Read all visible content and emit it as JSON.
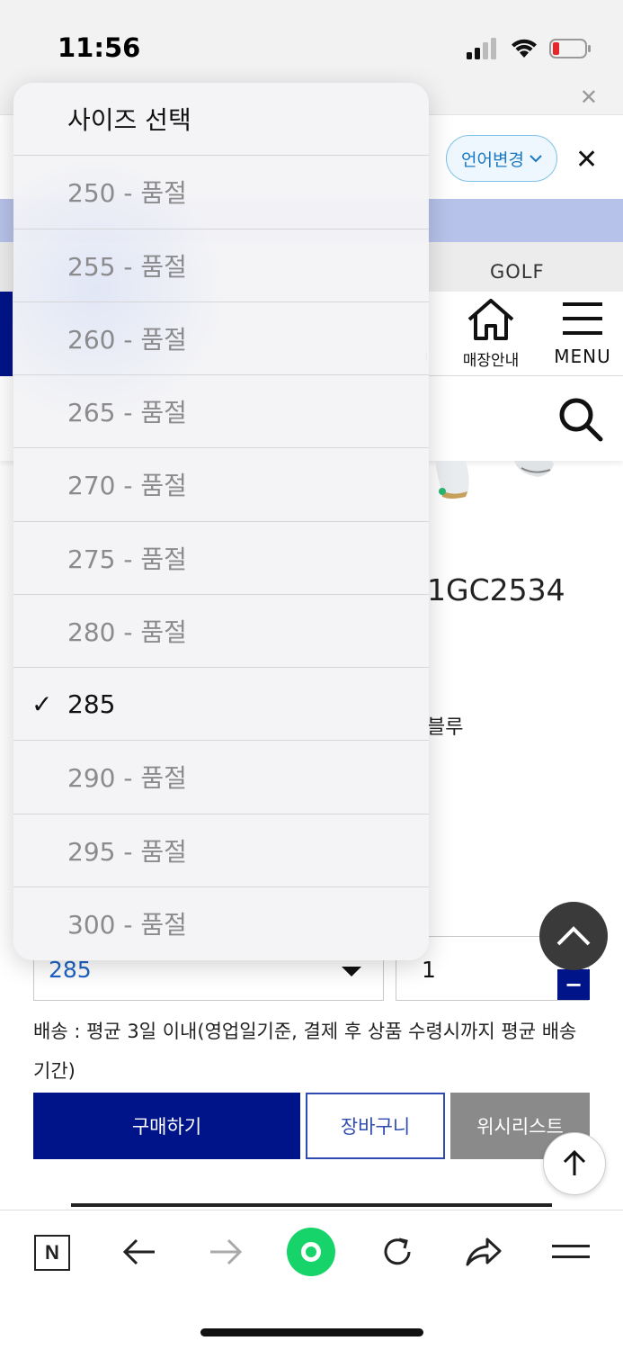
{
  "status_bar": {
    "time": "11:56"
  },
  "header": {
    "language_button": "언어변경"
  },
  "category": {
    "golf": "GOLF"
  },
  "nav": {
    "store_label": "매장안내",
    "menu_label": "MENU",
    "partial_label": "i"
  },
  "product": {
    "code_partial": "1GC2534",
    "color_partial": "블루"
  },
  "size_select": {
    "value": "285"
  },
  "quantity": {
    "value": "1",
    "minus_label": "−"
  },
  "delivery": {
    "text": "배송 : 평균 3일 이내(영업일기준, 결제 후 상품 수령시까지 평균 배송기간)"
  },
  "actions": {
    "buy": "구매하기",
    "cart": "장바구니",
    "wishlist": "위시리스트"
  },
  "toolbar": {
    "n_label": "N"
  },
  "dropdown": {
    "options": [
      {
        "label": "사이즈 선택",
        "type": "header"
      },
      {
        "label": "250 - 품절"
      },
      {
        "label": "255 - 품절"
      },
      {
        "label": "260 - 품절"
      },
      {
        "label": "265 - 품절"
      },
      {
        "label": "270 - 품절"
      },
      {
        "label": "275 - 품절"
      },
      {
        "label": "280 - 품절"
      },
      {
        "label": "285",
        "selected": true,
        "check": "✓"
      },
      {
        "label": "290 - 품절"
      },
      {
        "label": "295 - 품절"
      },
      {
        "label": "300 - 품절"
      }
    ]
  },
  "colors": {
    "brand_navy": "#001489",
    "link_blue": "#1e63c4",
    "green": "#17d46a",
    "battery_red": "#e6262b"
  }
}
